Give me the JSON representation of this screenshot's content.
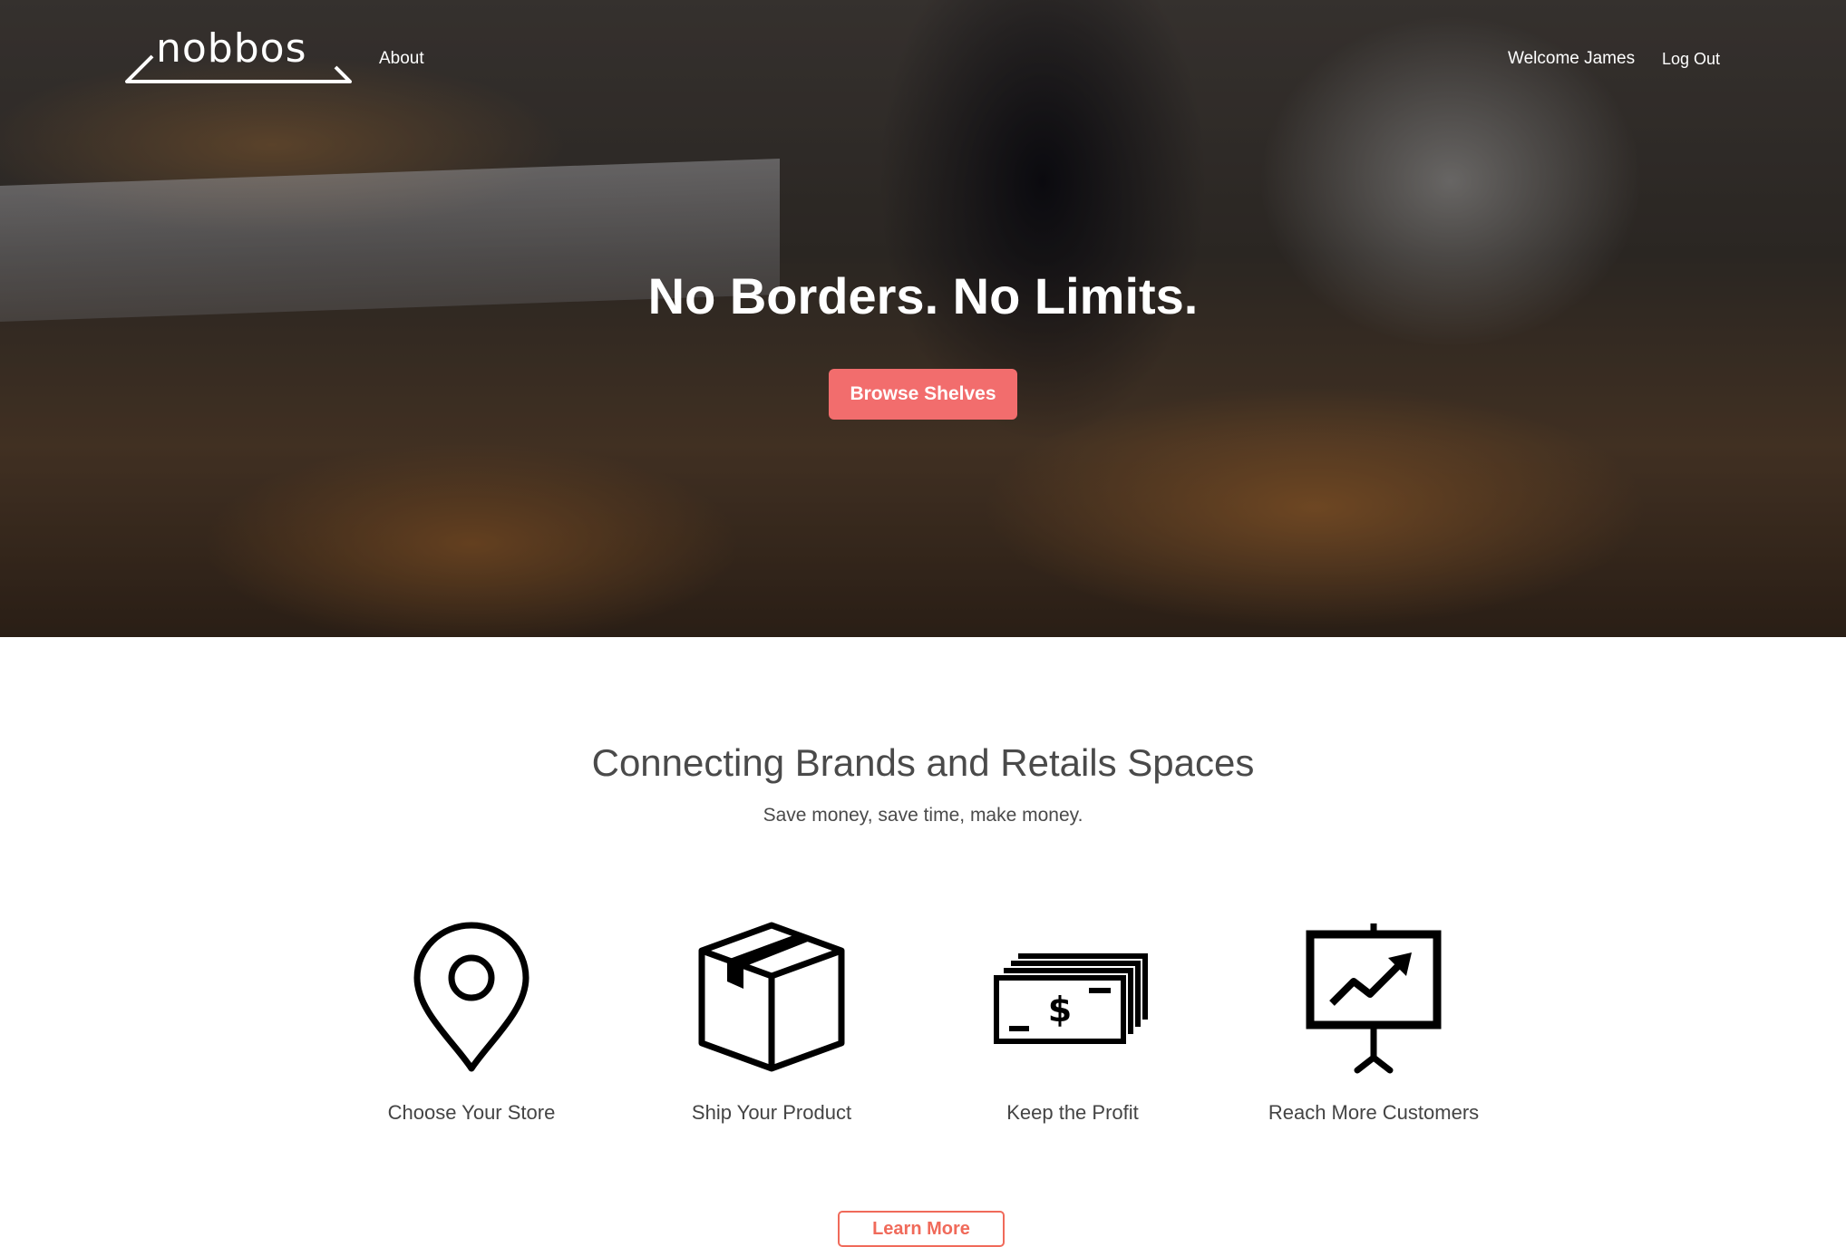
{
  "header": {
    "logo_text": "nobbos",
    "nav": {
      "about": "About"
    },
    "user": {
      "welcome": "Welcome James",
      "logout": "Log Out"
    }
  },
  "hero": {
    "title": "No Borders. No Limits.",
    "cta": "Browse Shelves"
  },
  "intro": {
    "title": "Connecting Brands and Retails Spaces",
    "subtitle": "Save money, save time, make money."
  },
  "features": [
    {
      "icon": "map-pin-icon",
      "label": "Choose Your Store"
    },
    {
      "icon": "box-icon",
      "label": "Ship Your Product"
    },
    {
      "icon": "cash-icon",
      "label": "Keep the Profit"
    },
    {
      "icon": "presentation-chart-icon",
      "label": "Reach More Customers"
    }
  ],
  "learn_more": "Learn More",
  "colors": {
    "accent": "#f26d6d",
    "text": "#4a4a4a",
    "hero_text": "#ffffff"
  }
}
